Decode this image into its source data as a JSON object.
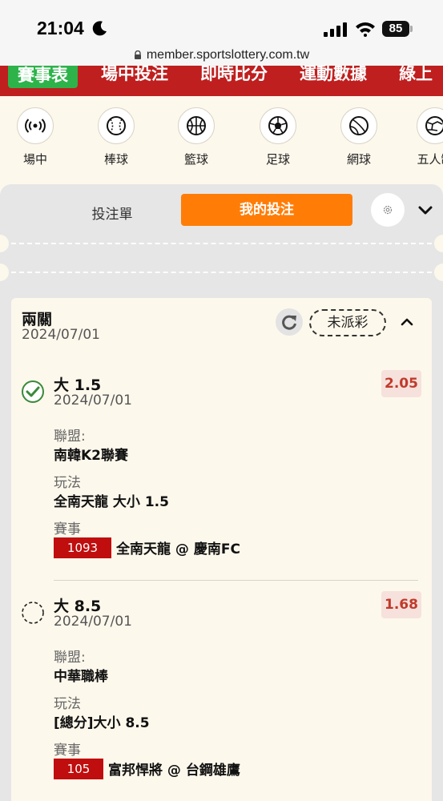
{
  "status": {
    "time": "21:04",
    "battery": "85",
    "url": "member.sportslottery.com.tw"
  },
  "topnav": {
    "tabs": [
      "賽事表",
      "場中投注",
      "即時比分",
      "運動數據",
      "綠上"
    ]
  },
  "sports": [
    {
      "label": "場中",
      "icon": "live-broadcast-icon"
    },
    {
      "label": "棒球",
      "icon": "baseball-icon"
    },
    {
      "label": "籃球",
      "icon": "basketball-icon"
    },
    {
      "label": "足球",
      "icon": "soccer-ball-icon"
    },
    {
      "label": "網球",
      "icon": "tennis-ball-icon"
    },
    {
      "label": "五人制",
      "icon": "futsal-icon"
    }
  ],
  "betslip": {
    "tab_betslip": "投注單",
    "tab_mybets": "我的投注",
    "accent": "#ff7d07"
  },
  "bet": {
    "title": "兩關",
    "date": "2024/07/01",
    "status": "未派彩",
    "legs": [
      {
        "selection": "大 1.5",
        "date": "2024/07/01",
        "odds": "2.05",
        "league_label": "聯盟:",
        "league": "南韓K2聯賽",
        "market_label": "玩法",
        "market": "全南天龍 大小 1.5",
        "event_label": "賽事",
        "game_no": "1093",
        "game": "全南天龍 @ 慶南FC",
        "state": "won"
      },
      {
        "selection": "大 8.5",
        "date": "2024/07/01",
        "odds": "1.68",
        "league_label": "聯盟:",
        "league": "中華職棒",
        "market_label": "玩法",
        "market": "[總分]大小 8.5",
        "event_label": "賽事",
        "game_no": "105",
        "game": "富邦悍將 @ 台鋼雄鷹",
        "state": "pending"
      }
    ]
  }
}
